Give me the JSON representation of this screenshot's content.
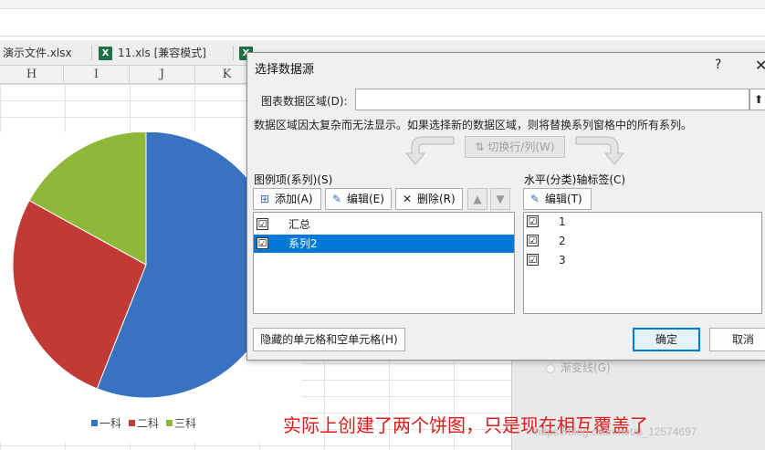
{
  "tabs": [
    {
      "label": "演示文件.xlsx",
      "icon": "none"
    },
    {
      "label": "11.xls  [兼容模式]",
      "icon": "excel-icon"
    },
    {
      "label": "",
      "icon": "excel-icon"
    }
  ],
  "columns": [
    "H",
    "I",
    "J",
    "K"
  ],
  "panel_option": "渐变线(G)",
  "chart_data": {
    "type": "pie",
    "categories": [
      "一科",
      "二科",
      "三科"
    ],
    "values": [
      56,
      27,
      17
    ],
    "colors": [
      "#3a72c2",
      "#c23a36",
      "#8db83a"
    ],
    "legend_position": "bottom",
    "title": ""
  },
  "dialog": {
    "title": "选择数据源",
    "help": "?",
    "close": "✕",
    "range_label": "图表数据区域(D):",
    "range_value": "",
    "range_button": "⬆",
    "info": "数据区域因太复杂而无法显示。如果选择新的数据区域，则将替换系列窗格中的所有系列。",
    "switch_label": "切换行/列(W)",
    "legend_section": "图例项(系列)(S)",
    "axis_section": "水平(分类)轴标签(C)",
    "add_label": "添加(A)",
    "edit_label": "编辑(E)",
    "delete_label": "删除(R)",
    "up_label": "▲",
    "down_label": "▼",
    "axis_edit_label": "编辑(T)",
    "series": [
      {
        "label": "汇总",
        "checked": "☑",
        "selected": false
      },
      {
        "label": "系列2",
        "checked": "☑",
        "selected": true
      }
    ],
    "axis_labels": [
      {
        "label": "1",
        "checked": "☑"
      },
      {
        "label": "2",
        "checked": "☑"
      },
      {
        "label": "3",
        "checked": "☑"
      }
    ],
    "hidden_cells_label": "隐藏的单元格和空单元格(H)",
    "ok_label": "确定",
    "cancel_label": "取消"
  },
  "annotation": "实际上创建了两个饼图，只是现在相互覆盖了",
  "watermark": "https://blog.csdn.net/u_12574697"
}
